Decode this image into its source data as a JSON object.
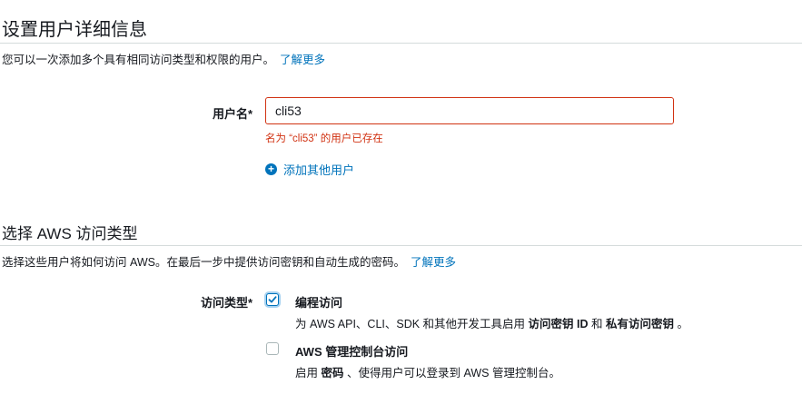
{
  "section1": {
    "title": "设置用户详细信息",
    "description": "您可以一次添加多个具有相同访问类型和权限的用户。",
    "learn_more": "了解更多"
  },
  "username": {
    "label": "用户名*",
    "value": "cli53",
    "error": "名为 “cli53” 的用户已存在",
    "add_user_label": "添加其他用户"
  },
  "section2": {
    "title": "选择 AWS 访问类型",
    "description": "选择这些用户将如何访问 AWS。在最后一步中提供访问密钥和自动生成的密码。",
    "learn_more": "了解更多"
  },
  "access_type": {
    "label": "访问类型*",
    "options": [
      {
        "title": "编程访问",
        "checked": true,
        "desc_prefix": "为 AWS API、CLI、SDK 和其他开发工具启用",
        "desc_bold1": "访问密钥 ID",
        "desc_mid": "和",
        "desc_bold2": "私有访问密钥",
        "desc_suffix": "。"
      },
      {
        "title": "AWS 管理控制台访问",
        "checked": false,
        "desc_prefix": "启用",
        "desc_bold1": "密码",
        "desc_suffix": "、使得用户可以登录到 AWS 管理控制台。"
      }
    ]
  },
  "colors": {
    "link": "#0073bb",
    "error": "#d13212",
    "divider": "#d5dbdb"
  },
  "icons": {
    "add_user": "plus-circle-icon",
    "checkbox_checked": "checkmark-icon"
  }
}
